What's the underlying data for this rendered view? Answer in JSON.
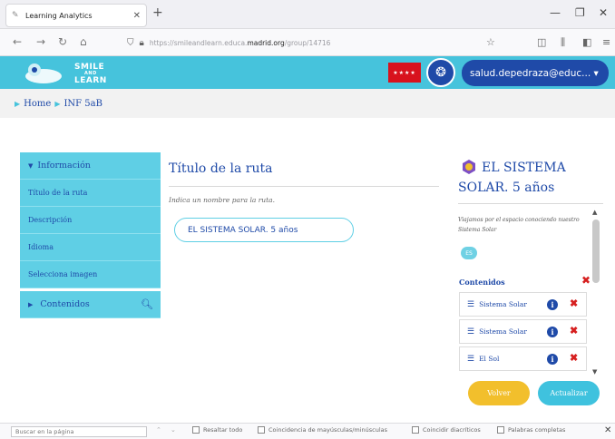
{
  "browser": {
    "tab_title": "Learning Analytics",
    "url_prefix": "https://smileandlearn.educa.",
    "url_domain": "madrid.org",
    "url_suffix": "/group/14716"
  },
  "header": {
    "logo_line1": "SMILE",
    "logo_line2": "AND",
    "logo_line3": "LEARN",
    "user": "salud.depedraza@educ... ▾"
  },
  "breadcrumb": {
    "home": "Home",
    "current": "INF 5aB"
  },
  "sidebar": {
    "section_info": "Información",
    "items": [
      "Título de la ruta",
      "Descripción",
      "Idioma",
      "Selecciona imagen"
    ],
    "section_contents": "Contenidos"
  },
  "main": {
    "title": "Título de la ruta",
    "hint": "Indica un nombre para la ruta.",
    "name_value": "EL SISTEMA SOLAR. 5 años"
  },
  "route_panel": {
    "title": "EL SISTEMA SOLAR. 5 años",
    "description": "Viajamos por el espacio conociendo nuestro Sistema Solar",
    "language_badge": "ES",
    "contents_label": "Contenidos",
    "contents": [
      "Sistema Solar",
      "Sistema Solar",
      "El Sol"
    ]
  },
  "buttons": {
    "back": "Volver",
    "update": "Actualizar"
  },
  "findbar": {
    "placeholder": "Buscar en la página",
    "opt_highlight": "Resaltar todo",
    "opt_case": "Coincidencia de mayúsculas/minúsculas",
    "opt_diacritics": "Coincidir diacríticos",
    "opt_words": "Palabras completas"
  },
  "colors": {
    "brand_cyan": "#46c3dc",
    "brand_blue": "#1f4aa8",
    "accent_yellow": "#f2bf2c",
    "delete_red": "#d61f1f"
  }
}
